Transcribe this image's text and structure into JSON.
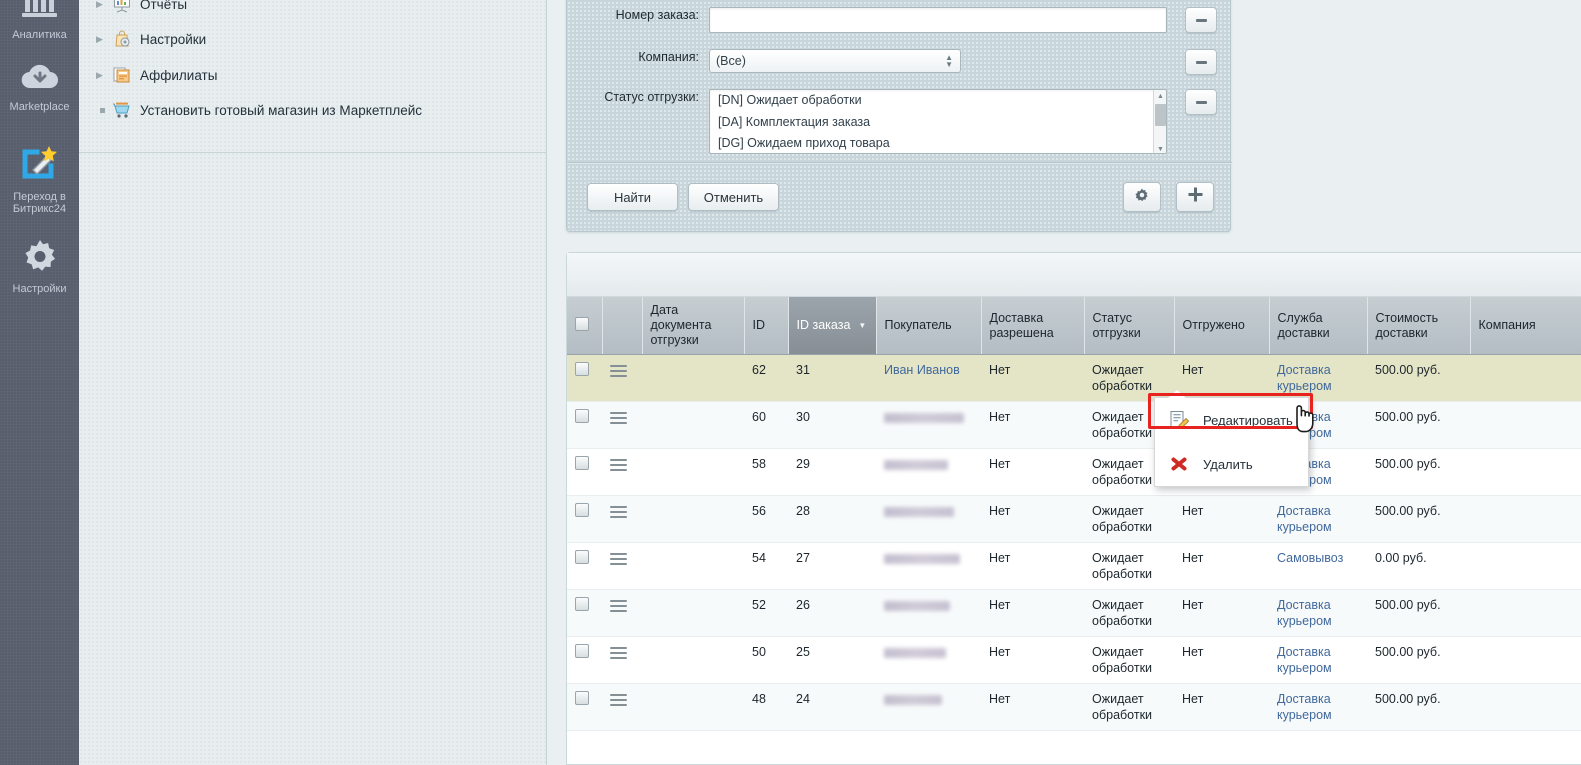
{
  "rail": {
    "items": [
      {
        "label": "Аналитика",
        "icon": "analytics-icon"
      },
      {
        "label": "Marketplace",
        "icon": "cloud-download-icon"
      },
      {
        "label": "Переход в Битрикс24",
        "icon": "magic-wand-icon"
      },
      {
        "label": "Настройки",
        "icon": "gear-icon"
      }
    ]
  },
  "tree": {
    "items": [
      {
        "label": "Отчёты",
        "icon": "report-chart-icon",
        "expander": "arrow"
      },
      {
        "label": "Настройки",
        "icon": "settings-bag-icon",
        "expander": "arrow"
      },
      {
        "label": "Аффилиаты",
        "icon": "affiliate-icon",
        "expander": "arrow"
      },
      {
        "label": "Установить готовый магазин из Маркетплейс",
        "icon": "shop-cart-icon",
        "expander": "bullet"
      }
    ]
  },
  "filter": {
    "rows": [
      {
        "label": "Номер заказа:",
        "type": "text",
        "value": "",
        "remove_label": "−"
      },
      {
        "label": "Компания:",
        "type": "select",
        "value": "(Все)",
        "remove_label": "−"
      },
      {
        "label": "Статус отгрузки:",
        "type": "list",
        "remove_label": "−",
        "options": [
          "[DN] Ожидает обработки",
          "[DA] Комплектация заказа",
          "[DG] Ожидаем приход товара"
        ]
      }
    ],
    "search_button": "Найти",
    "cancel_button": "Отменить",
    "settings_icon": "gear-icon",
    "add_icon": "plus-icon"
  },
  "grid": {
    "columns": [
      "",
      "",
      "Дата документа отгрузки",
      "ID",
      "ID заказа",
      "Покупатель",
      "Доставка разрешена",
      "Статус отгрузки",
      "Отгружено",
      "Служба доставки",
      "Стоимость доставки",
      "Компания"
    ],
    "sorted_column": "ID заказа",
    "sort_direction": "desc",
    "rows": [
      {
        "ship_date": "",
        "id": "62",
        "order_id": "31",
        "customer": "Иван Иванов",
        "customer_redacted": false,
        "delivery_allowed": "Нет",
        "ship_status": "Ожидает обработки",
        "shipped": "Нет",
        "delivery_service": "Доставка курьером",
        "delivery_cost": "500.00 руб.",
        "company": "",
        "highlight": true
      },
      {
        "ship_date": "",
        "id": "60",
        "order_id": "30",
        "customer": "",
        "customer_redacted": true,
        "delivery_allowed": "Нет",
        "ship_status": "Ожидает обработки",
        "shipped": "Нет",
        "delivery_service": "Доставка курьером",
        "delivery_cost": "500.00 руб.",
        "company": "",
        "highlight": false
      },
      {
        "ship_date": "",
        "id": "58",
        "order_id": "29",
        "customer": "",
        "customer_redacted": true,
        "delivery_allowed": "Нет",
        "ship_status": "Ожидает обработки",
        "shipped": "Нет",
        "delivery_service": "Доставка курьером",
        "delivery_cost": "500.00 руб.",
        "company": "",
        "highlight": false
      },
      {
        "ship_date": "",
        "id": "56",
        "order_id": "28",
        "customer": "",
        "customer_redacted": true,
        "delivery_allowed": "Нет",
        "ship_status": "Ожидает обработки",
        "shipped": "Нет",
        "delivery_service": "Доставка курьером",
        "delivery_cost": "500.00 руб.",
        "company": "",
        "highlight": false
      },
      {
        "ship_date": "",
        "id": "54",
        "order_id": "27",
        "customer": "",
        "customer_redacted": true,
        "delivery_allowed": "Нет",
        "ship_status": "Ожидает обработки",
        "shipped": "Нет",
        "delivery_service": "Самовывоз",
        "delivery_cost": "0.00 руб.",
        "company": "",
        "highlight": false
      },
      {
        "ship_date": "",
        "id": "52",
        "order_id": "26",
        "customer": "",
        "customer_redacted": true,
        "delivery_allowed": "Нет",
        "ship_status": "Ожидает обработки",
        "shipped": "Нет",
        "delivery_service": "Доставка курьером",
        "delivery_cost": "500.00 руб.",
        "company": "",
        "highlight": false
      },
      {
        "ship_date": "",
        "id": "50",
        "order_id": "25",
        "customer": "",
        "customer_redacted": true,
        "delivery_allowed": "Нет",
        "ship_status": "Ожидает обработки",
        "shipped": "Нет",
        "delivery_service": "Доставка курьером",
        "delivery_cost": "500.00 руб.",
        "company": "",
        "highlight": false
      },
      {
        "ship_date": "",
        "id": "48",
        "order_id": "24",
        "customer": "",
        "customer_redacted": true,
        "delivery_allowed": "Нет",
        "ship_status": "Ожидает обработки",
        "shipped": "Нет",
        "delivery_service": "Доставка курьером",
        "delivery_cost": "500.00 руб.",
        "company": "",
        "highlight": false
      }
    ]
  },
  "context_menu": {
    "items": [
      {
        "label": "Редактировать",
        "icon": "edit-document-icon",
        "highlighted": true
      },
      {
        "label": "Удалить",
        "icon": "delete-cross-icon",
        "highlighted": false
      }
    ],
    "highlight_color": "#e8221e"
  },
  "colors": {
    "rail_bg": "#575e6d",
    "panel_bg": "#e8eef0",
    "filter_bg": "#c8d6dc",
    "row_highlight": "#e4e4c6",
    "link": "#41699c"
  }
}
